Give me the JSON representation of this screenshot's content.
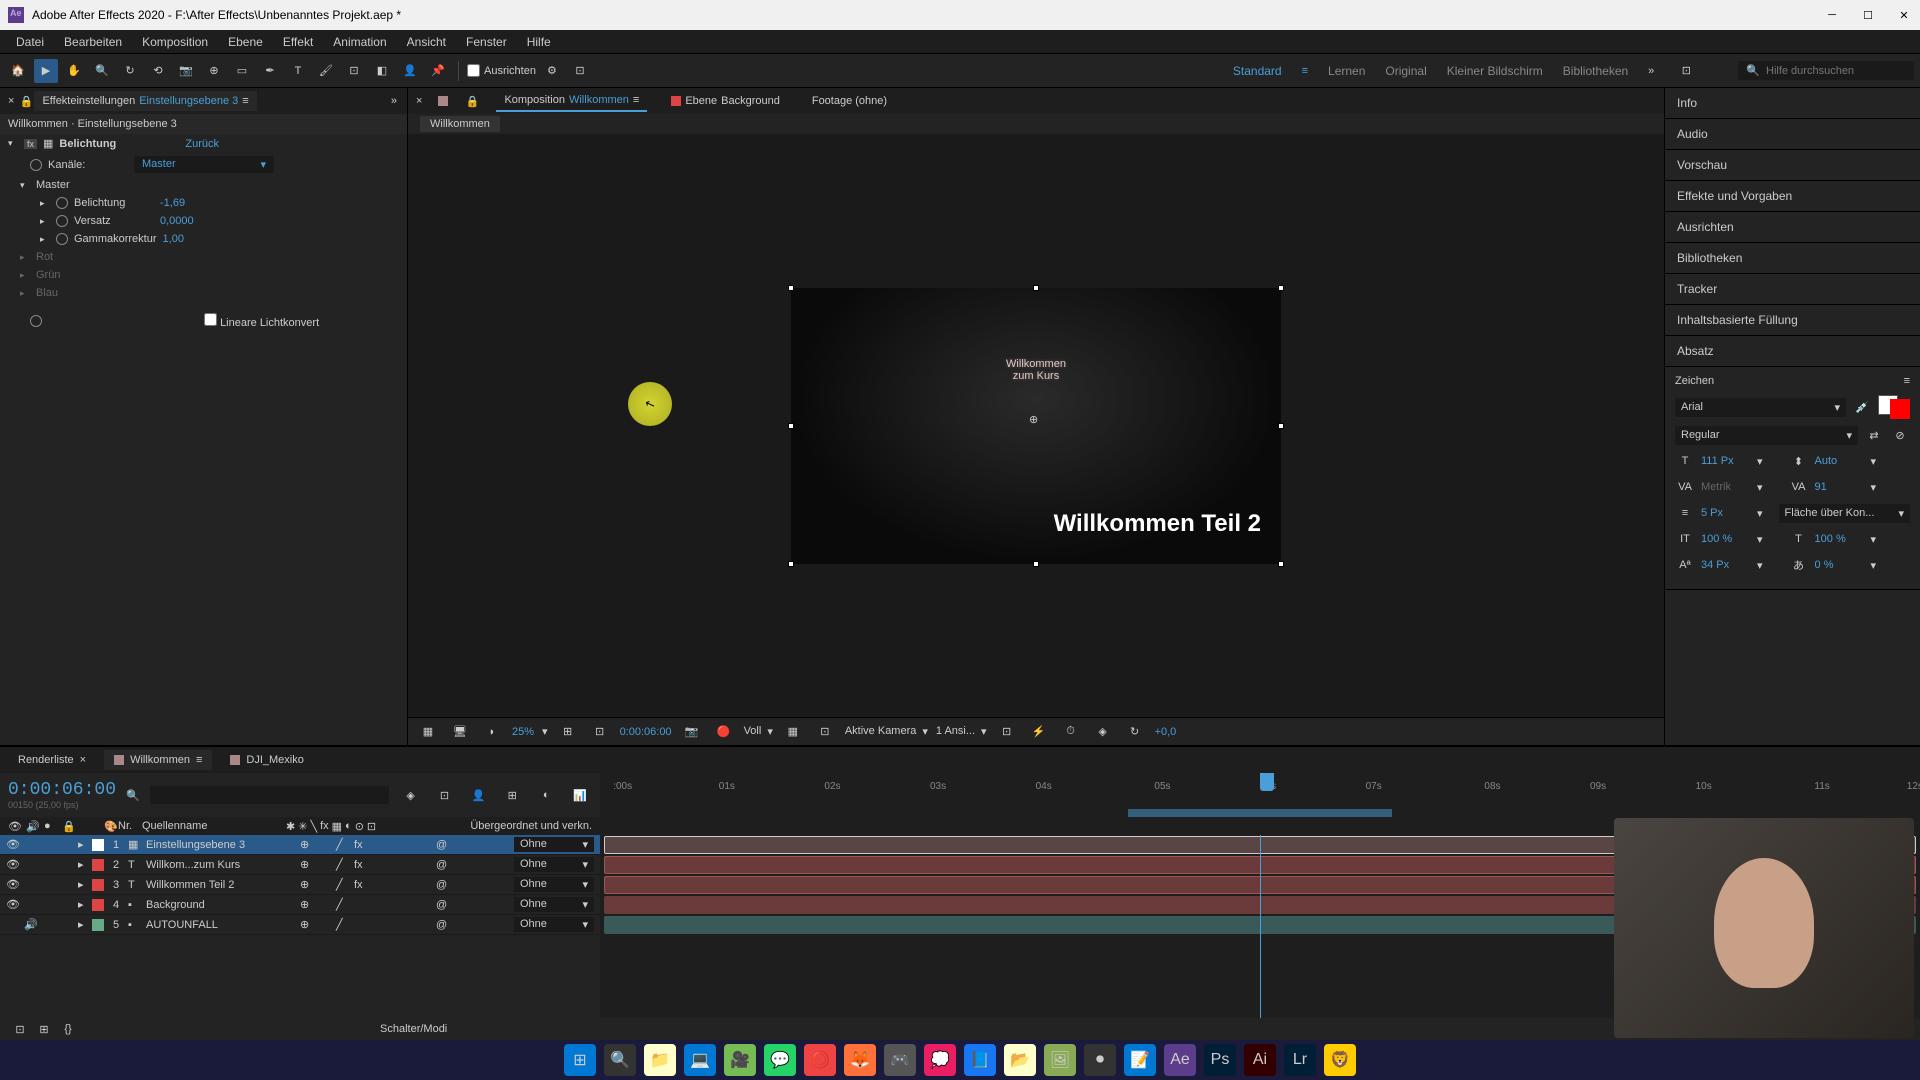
{
  "titlebar": {
    "title": "Adobe After Effects 2020 - F:\\After Effects\\Unbenanntes Projekt.aep *"
  },
  "menu": [
    "Datei",
    "Bearbeiten",
    "Komposition",
    "Ebene",
    "Effekt",
    "Animation",
    "Ansicht",
    "Fenster",
    "Hilfe"
  ],
  "toolbar": {
    "checkbox_label": "Ausrichten",
    "search_placeholder": "Hilfe durchsuchen"
  },
  "workspaces": {
    "active": "Standard",
    "items": [
      "Standard",
      "Lernen",
      "Original",
      "Kleiner Bildschirm",
      "Bibliotheken"
    ]
  },
  "effect_panel": {
    "tab_label": "Effekteinstellungen",
    "tab_link": "Einstellungsebene 3",
    "breadcrumb": "Willkommen · Einstellungsebene 3",
    "effect_name": "Belichtung",
    "reset": "Zurück",
    "channels_label": "Kanäle:",
    "channels_value": "Master",
    "master": "Master",
    "params": {
      "exposure_label": "Belichtung",
      "exposure_value": "-1,69",
      "offset_label": "Versatz",
      "offset_value": "0,0000",
      "gamma_label": "Gammakorrektur",
      "gamma_value": "1,00"
    },
    "disabled": [
      "Rot",
      "Grün",
      "Blau"
    ],
    "linear_label": "Lineare Lichtkonvert"
  },
  "viewer": {
    "tabs": {
      "comp_prefix": "Komposition",
      "comp_name": "Willkommen",
      "layer_prefix": "Ebene",
      "layer_name": "Background",
      "footage": "Footage (ohne)"
    },
    "crumb": "Willkommen",
    "text1_line1": "Willkommen",
    "text1_line2": "zum Kurs",
    "text2": "Willkommen Teil 2",
    "controls": {
      "zoom": "25%",
      "time": "0:00:06:00",
      "resolution": "Voll",
      "camera": "Aktive Kamera",
      "views": "1 Ansi...",
      "exposure": "+0,0"
    }
  },
  "right_panels": {
    "items": [
      "Info",
      "Audio",
      "Vorschau",
      "Effekte und Vorgaben",
      "Ausrichten",
      "Bibliotheken",
      "Tracker",
      "Inhaltsbasierte Füllung",
      "Absatz"
    ],
    "char_title": "Zeichen",
    "font": "Arial",
    "style": "Regular",
    "size": "111 Px",
    "leading": "Auto",
    "kerning": "Metrik",
    "tracking": "91",
    "stroke": "5 Px",
    "stroke_mode": "Fläche über Kon...",
    "hscale": "100 %",
    "vscale": "100 %",
    "baseline": "34 Px",
    "tsume": "0 %"
  },
  "timeline": {
    "tabs": {
      "render": "Renderliste",
      "comp": "Willkommen",
      "other": "DJI_Mexiko"
    },
    "timecode": "0:00:06:00",
    "timecode_sub": "00150 (25,00 fps)",
    "columns": {
      "nr": "Nr.",
      "name": "Quellenname",
      "parent": "Übergeordnet und verkn."
    },
    "ticks": [
      ":00s",
      "01s",
      "02s",
      "03s",
      "04s",
      "05s",
      "06s",
      "07s",
      "08s",
      "09s",
      "10s",
      "11s",
      "12s"
    ],
    "layers": [
      {
        "num": "1",
        "name": "Einstellungsebene 3",
        "color": "#fff",
        "parent": "Ohne",
        "selected": true,
        "type": "adj"
      },
      {
        "num": "2",
        "name": "Willkom...zum Kurs",
        "color": "#d44",
        "parent": "Ohne",
        "type": "txt"
      },
      {
        "num": "3",
        "name": "Willkommen Teil 2",
        "color": "#d44",
        "parent": "Ohne",
        "type": "txt"
      },
      {
        "num": "4",
        "name": "Background",
        "color": "#d44",
        "parent": "Ohne",
        "type": "solid"
      },
      {
        "num": "5",
        "name": "AUTOUNFALL",
        "color": "#6a8",
        "parent": "Ohne",
        "type": "audio"
      }
    ],
    "footer": "Schalter/Modi"
  },
  "taskbar_icons": [
    "⊞",
    "🔍",
    "📁",
    "💻",
    "🎥",
    "💬",
    "⭕",
    "🦊",
    "🎮",
    "💭",
    "📘",
    "📂",
    "🖼",
    "⏺",
    "📝",
    "Ae",
    "Ps",
    "Ai",
    "Lr",
    "🦁"
  ]
}
